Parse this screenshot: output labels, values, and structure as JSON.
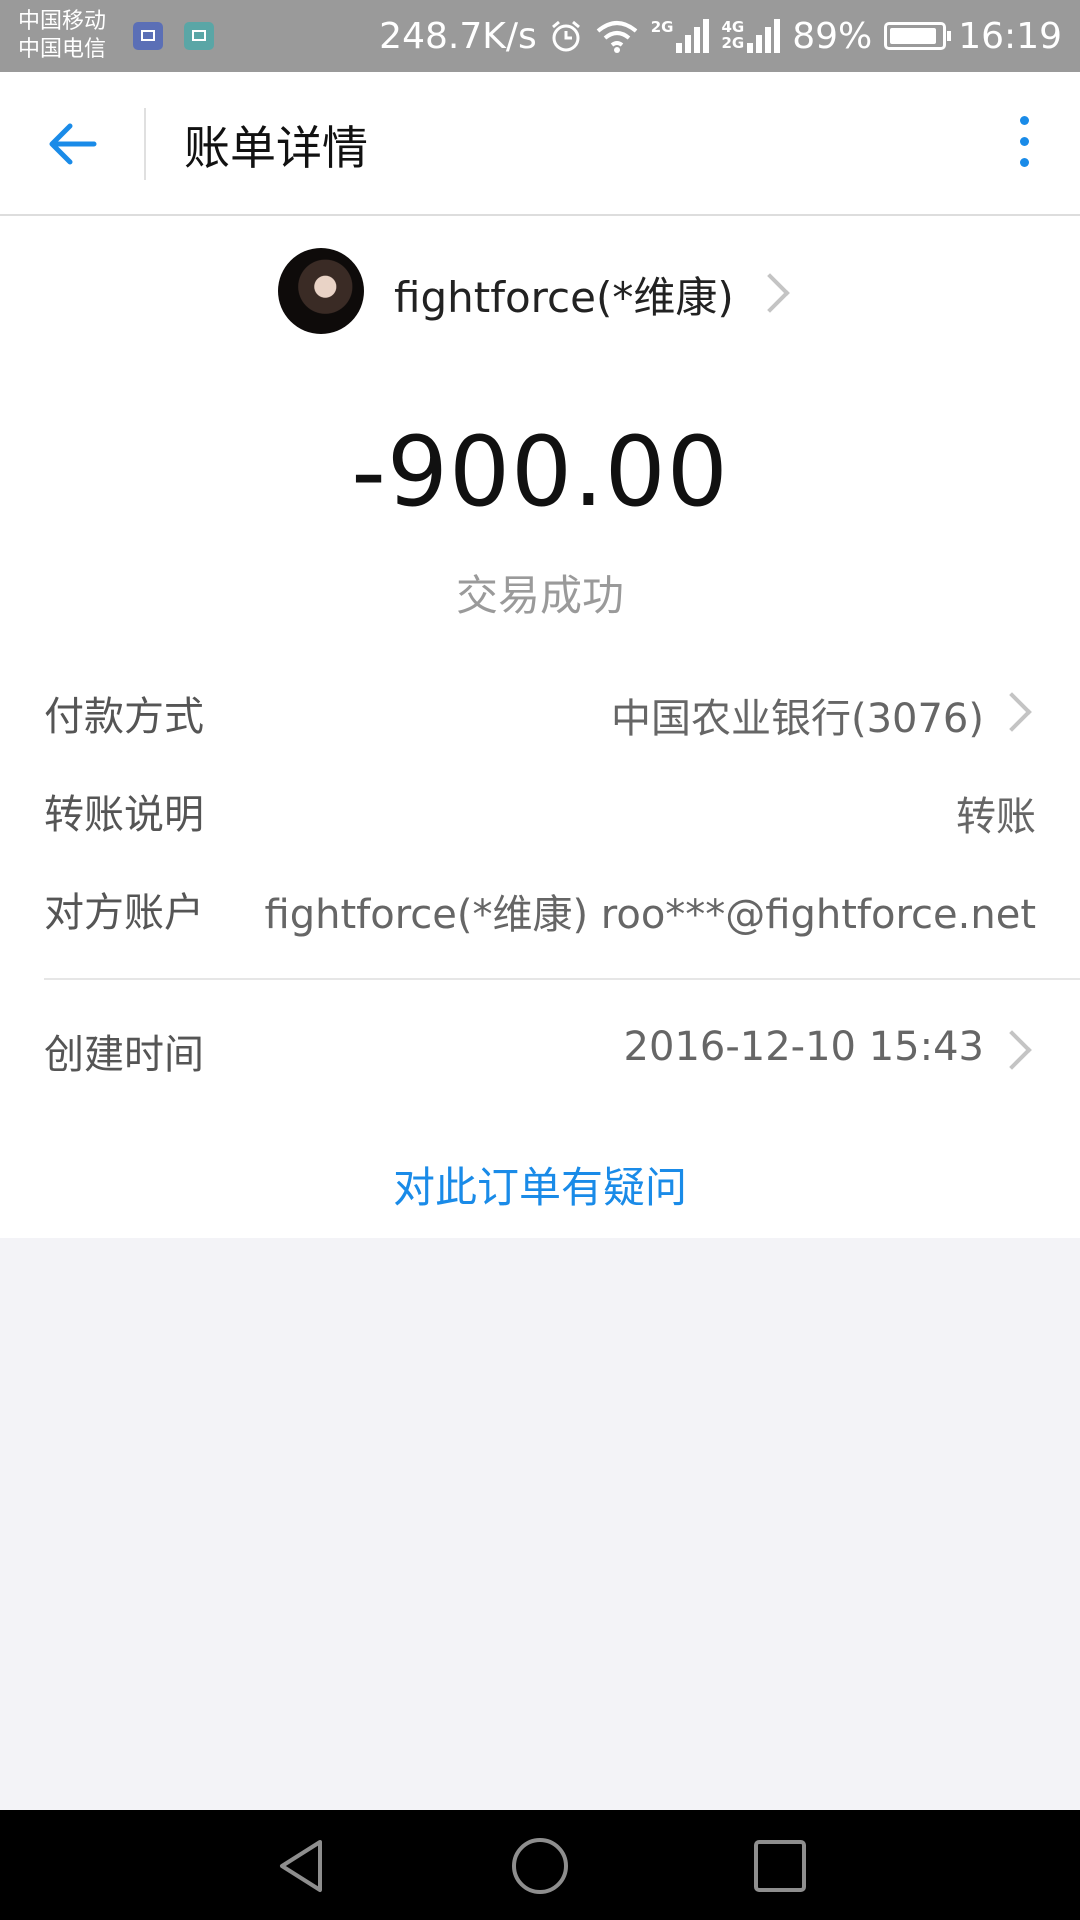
{
  "status_bar": {
    "carrier_1": "中国移动",
    "carrier_2": "中国电信",
    "speed": "248.7K/s",
    "net_2g": "2G",
    "net_4g": "4G",
    "net_2g_b": "2G",
    "battery": "89%",
    "time": "16:19"
  },
  "header": {
    "title": "账单详情",
    "accent_color": "#1a8be8"
  },
  "payee": {
    "name": "fightforce(*维康)"
  },
  "transaction": {
    "amount": "-900.00",
    "status": "交易成功"
  },
  "details": {
    "payment_method_label": "付款方式",
    "payment_method_value": "中国农业银行(3076)",
    "note_label": "转账说明",
    "note_value": "转账",
    "account_label": "对方账户",
    "account_value": "fightforce(*维康) roo***@fightforce.net",
    "created_label": "创建时间",
    "created_value": "2016-12-10 15:43"
  },
  "question_link": "对此订单有疑问",
  "icons": {
    "back": "arrow-left-icon",
    "more": "more-vertical-icon",
    "nav": [
      "back-triangle-icon",
      "home-circle-icon",
      "recents-square-icon"
    ]
  }
}
